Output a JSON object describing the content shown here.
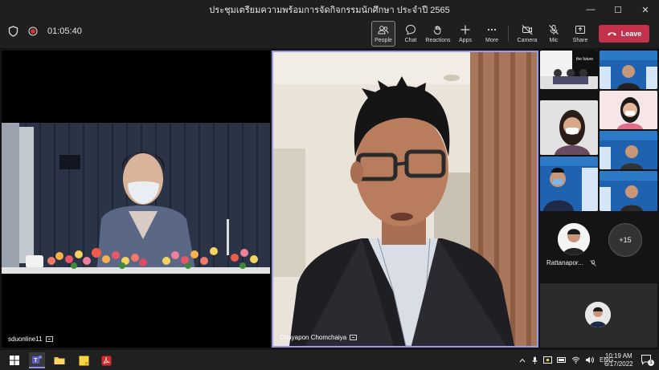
{
  "window": {
    "title": "ประชุมเตรียมความพร้อมการจัดกิจกรรมนักศึกษา ประจำปี 2565",
    "min": "—",
    "max": "☐",
    "close": "✕"
  },
  "toolbar": {
    "timer": "01:05:40",
    "people": "People",
    "chat": "Chat",
    "reactions": "Reactions",
    "apps": "Apps",
    "more": "More",
    "camera": "Camera",
    "mic": "Mic",
    "share": "Share",
    "leave": "Leave"
  },
  "participants": {
    "left_tile_name": "sduonline11",
    "center_tile_name": "Chayapon Chomchaiya",
    "side_name": "Rattanapor...",
    "overflow_count": "+15"
  },
  "taskbar": {
    "lang": "ENG",
    "time": "10:19 AM",
    "date": "6/17/2022",
    "notif": "1"
  },
  "colors": {
    "leave": "#c4314b",
    "active_border": "#9a9ae8",
    "teams": "#5b5fc7"
  }
}
